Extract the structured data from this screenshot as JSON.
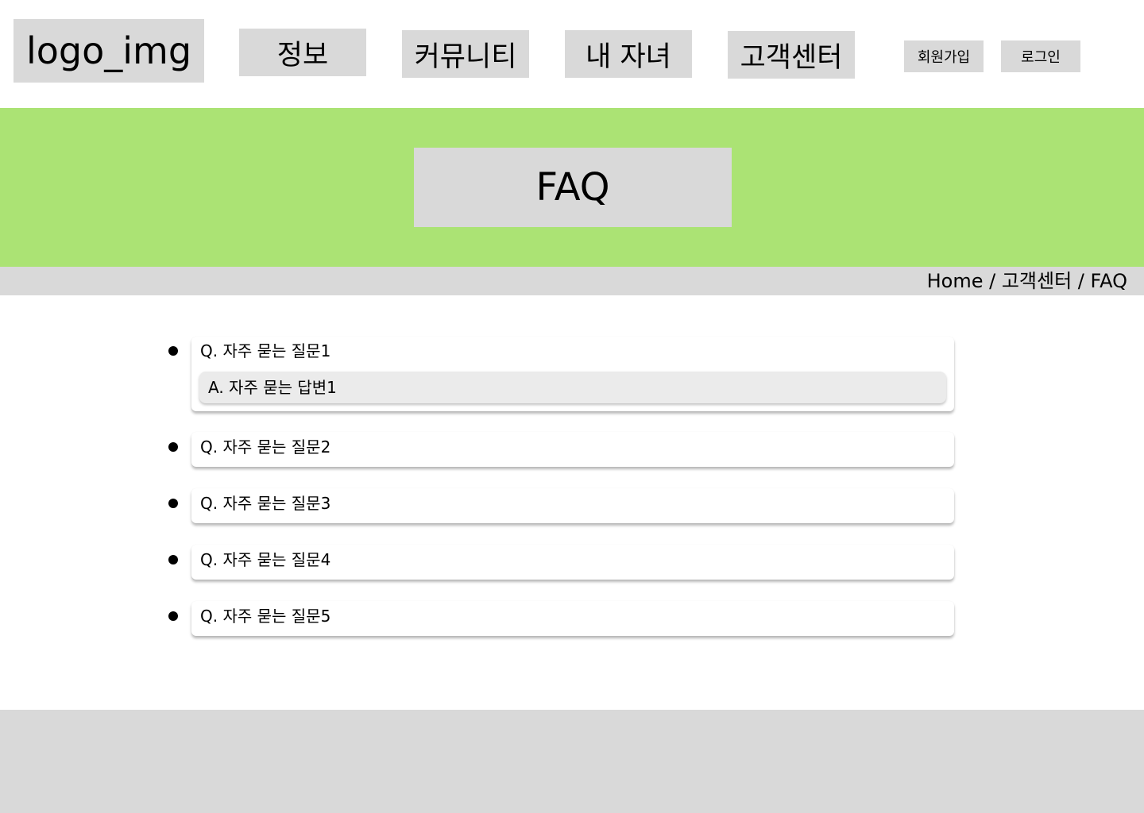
{
  "header": {
    "logo": "logo_img",
    "nav": [
      {
        "label": "정보"
      },
      {
        "label": "커뮤니티"
      },
      {
        "label": "내 자녀"
      },
      {
        "label": "고객센터"
      }
    ],
    "auth": {
      "signup_label": "회원가입",
      "login_label": "로그인"
    }
  },
  "hero": {
    "title": "FAQ"
  },
  "breadcrumb": "Home / 고객센터 / FAQ",
  "faq": [
    {
      "question": "Q. 자주 묻는 질문1",
      "answer": "A. 자주 묻는 답변1"
    },
    {
      "question": "Q. 자주 묻는 질문2"
    },
    {
      "question": "Q. 자주 묻는 질문3"
    },
    {
      "question": "Q. 자주 묻는 질문4"
    },
    {
      "question": "Q. 자주 묻는 질문5"
    }
  ],
  "colors": {
    "hero_bg": "#abe374",
    "placeholder_gray": "#d9d9d9",
    "answer_bg": "#ebebeb"
  }
}
